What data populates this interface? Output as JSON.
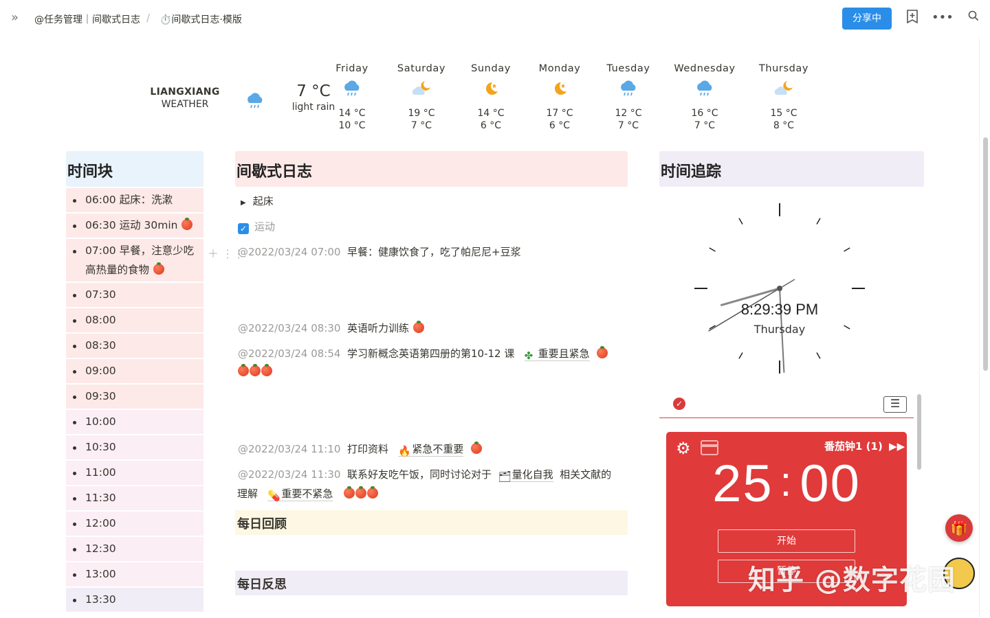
{
  "breadcrumb": {
    "workspace": "@任务管理｜间歇式日志",
    "separator": "/",
    "page": "⏱️间歇式日志·模版"
  },
  "toolbar": {
    "share_label": "分享中"
  },
  "weather": {
    "location": "LIANGXIANG",
    "label": "WEATHER",
    "current_temp": "7 °C",
    "current_desc": "light rain",
    "current_icon": "rain-cloud-icon",
    "days": [
      {
        "name": "Friday",
        "hi": "14 °C",
        "lo": "10 °C",
        "icon": "rain-cloud-icon"
      },
      {
        "name": "Saturday",
        "hi": "19 °C",
        "lo": "7 °C",
        "icon": "partly-cloudy-night-icon"
      },
      {
        "name": "Sunday",
        "hi": "14 °C",
        "lo": "6 °C",
        "icon": "moon-icon"
      },
      {
        "name": "Monday",
        "hi": "17 °C",
        "lo": "6 °C",
        "icon": "moon-icon"
      },
      {
        "name": "Tuesday",
        "hi": "12 °C",
        "lo": "7 °C",
        "icon": "rain-cloud-icon"
      },
      {
        "name": "Wednesday",
        "hi": "16 °C",
        "lo": "7 °C",
        "icon": "rain-cloud-icon"
      },
      {
        "name": "Thursday",
        "hi": "15 °C",
        "lo": "8 °C",
        "icon": "partly-cloudy-night-icon"
      }
    ]
  },
  "timeblocks": {
    "title": "时间块",
    "items": [
      {
        "text": "06:00  起床：洗漱",
        "tomatoes": 0
      },
      {
        "text": "06:30  运动  30min",
        "tomatoes": 1
      },
      {
        "text": "07:00  早餐，注意少吃高热量的食物",
        "tomatoes": 1
      },
      {
        "text": "07:30",
        "tomatoes": 0
      },
      {
        "text": "08:00",
        "tomatoes": 0
      },
      {
        "text": "08:30",
        "tomatoes": 0
      },
      {
        "text": "09:00",
        "tomatoes": 0
      },
      {
        "text": "09:30",
        "tomatoes": 0
      },
      {
        "text": "10:00",
        "tomatoes": 0
      },
      {
        "text": "10:30",
        "tomatoes": 0
      },
      {
        "text": "11:00",
        "tomatoes": 0
      },
      {
        "text": "11:30",
        "tomatoes": 0
      },
      {
        "text": "12:00",
        "tomatoes": 0
      },
      {
        "text": "12:30",
        "tomatoes": 0
      },
      {
        "text": "13:00",
        "tomatoes": 0
      },
      {
        "text": "13:30",
        "tomatoes": 0
      }
    ]
  },
  "log": {
    "title": "间歇式日志",
    "toggle_label": "起床",
    "checkbox_label": "运动",
    "entries": [
      {
        "stamp": "@2022/03/24 07:00",
        "text": "早餐：健康饮食了，吃了帕尼尼+豆浆"
      },
      {
        "stamp": "@2022/03/24 08:30",
        "text": "英语听力训练"
      },
      {
        "stamp": "@2022/03/24 08:54",
        "text": "学习新概念英语第四册的第10-12 课",
        "tag": "重要且紧急"
      },
      {
        "stamp": "@2022/03/24 11:10",
        "text": "打印资料",
        "tag": "紧急不重要"
      },
      {
        "stamp": "@2022/03/24 11:30",
        "text": "联系好友吃午饭，同时讨论对于",
        "link": "量化自我",
        "text2": "相关文献的",
        "text3": "理解",
        "tag": "重要不紧急"
      }
    ],
    "review_title": "每日回顾",
    "reflect_title": "每日反思"
  },
  "tracker": {
    "title": "时间追踪",
    "clock_time": "8:29:39 PM",
    "clock_day": "Thursday"
  },
  "pomodoro": {
    "title": "番茄钟1 (1)",
    "time_minutes": "25",
    "time_sep": ":",
    "time_seconds": "00",
    "start_label": "开始",
    "second_label": "暂停"
  },
  "watermark": "知乎 @数字花园",
  "colors": {
    "accent": "#2a8ee8",
    "pomodoro": "#e03a3a",
    "timeblock_header": "#e8f3fb",
    "log_header": "#fde9e8",
    "tracker_header": "#f1edf7",
    "review_bg": "#fdf7e3",
    "reflect_bg": "#f1edf7"
  }
}
